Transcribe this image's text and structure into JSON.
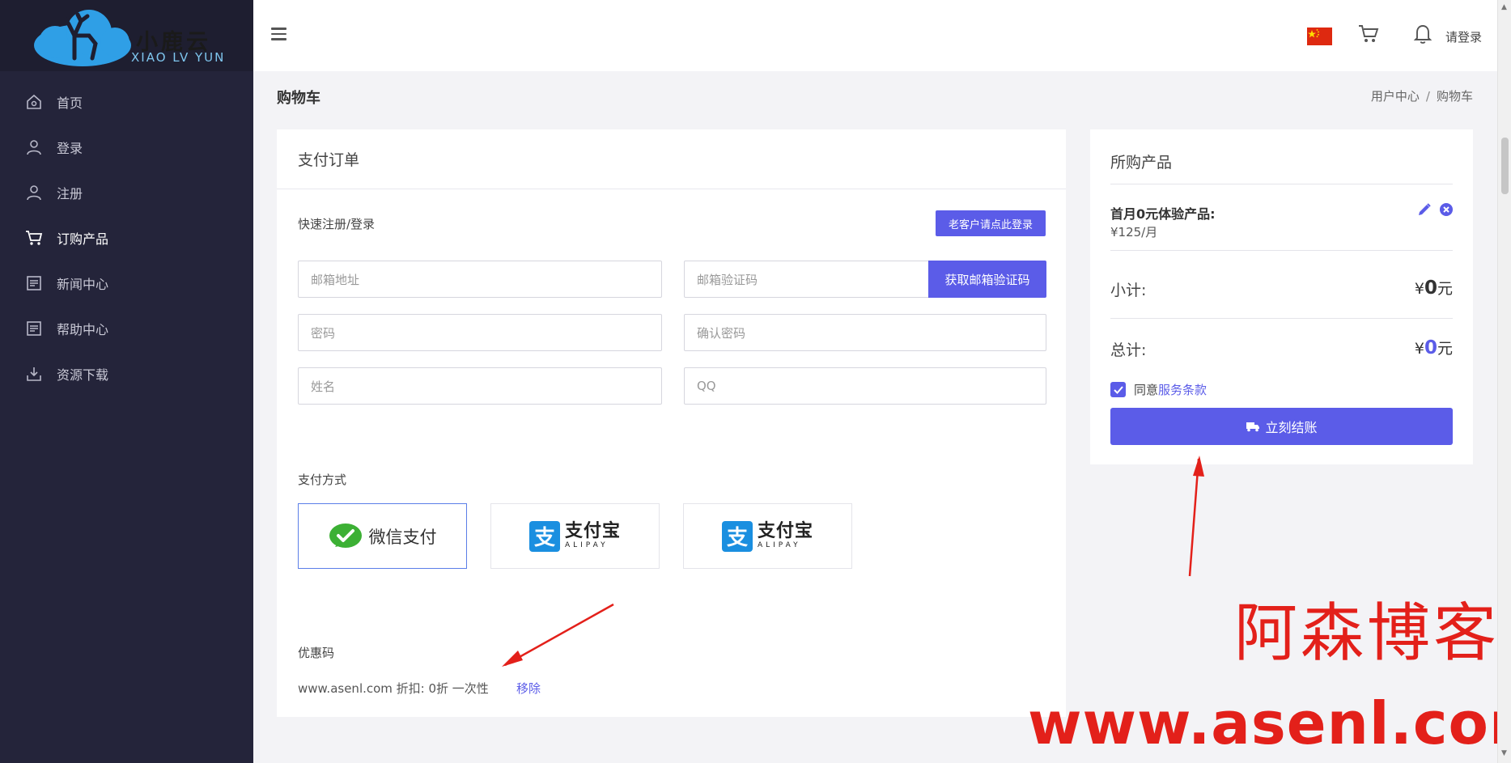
{
  "brand": {
    "name_cn": "小鹿云",
    "name_en": "XIAO LV YUN"
  },
  "sidebar": {
    "items": [
      {
        "label": "首页",
        "icon": "home-icon"
      },
      {
        "label": "登录",
        "icon": "user-icon"
      },
      {
        "label": "注册",
        "icon": "user-icon"
      },
      {
        "label": "订购产品",
        "icon": "cart-icon",
        "active": true
      },
      {
        "label": "新闻中心",
        "icon": "document-icon"
      },
      {
        "label": "帮助中心",
        "icon": "document-icon"
      },
      {
        "label": "资源下载",
        "icon": "download-icon"
      }
    ]
  },
  "header": {
    "login_label": "请登录",
    "flag": "china-flag-icon"
  },
  "page": {
    "title": "购物车",
    "breadcrumb": [
      "用户中心",
      "购物车"
    ],
    "breadcrumb_separator": "/"
  },
  "order_form": {
    "card_title": "支付订单",
    "quick_label": "快速注册/登录",
    "old_customer_button": "老客户请点此登录",
    "fields": {
      "email": "邮箱地址",
      "email_code": "邮箱验证码",
      "password": "密码",
      "confirm_password": "确认密码",
      "name": "姓名",
      "qq": "QQ"
    },
    "get_code_button": "获取邮箱验证码",
    "payment_label": "支付方式",
    "payment_methods": [
      {
        "label": "微信支付",
        "selected": true
      },
      {
        "label": "支付宝",
        "sub": "ALIPAY"
      },
      {
        "label": "支付宝",
        "sub": "ALIPAY"
      }
    ],
    "coupon_label": "优惠码",
    "coupon_text": "www.asenl.com 折扣: 0折 一次性",
    "coupon_remove": "移除"
  },
  "summary": {
    "title": "所购产品",
    "product_name": "首月0元体验产品:",
    "product_price": "¥125/月",
    "subtotal_label": "小计:",
    "subtotal_currency": "¥",
    "subtotal_value": "0",
    "subtotal_unit": "元",
    "total_label": "总计:",
    "total_currency": "¥",
    "total_value": "0",
    "total_unit": "元",
    "agree_prefix": "同意",
    "agree_link": "服务条款",
    "agree_checked": true,
    "checkout_button": "立刻结账"
  },
  "watermark": {
    "cn": "阿森博客",
    "url": "www.asenl.com"
  },
  "colors": {
    "accent": "#5b5ce8",
    "sidebar": "#24243a",
    "annotation": "#e3201a"
  }
}
